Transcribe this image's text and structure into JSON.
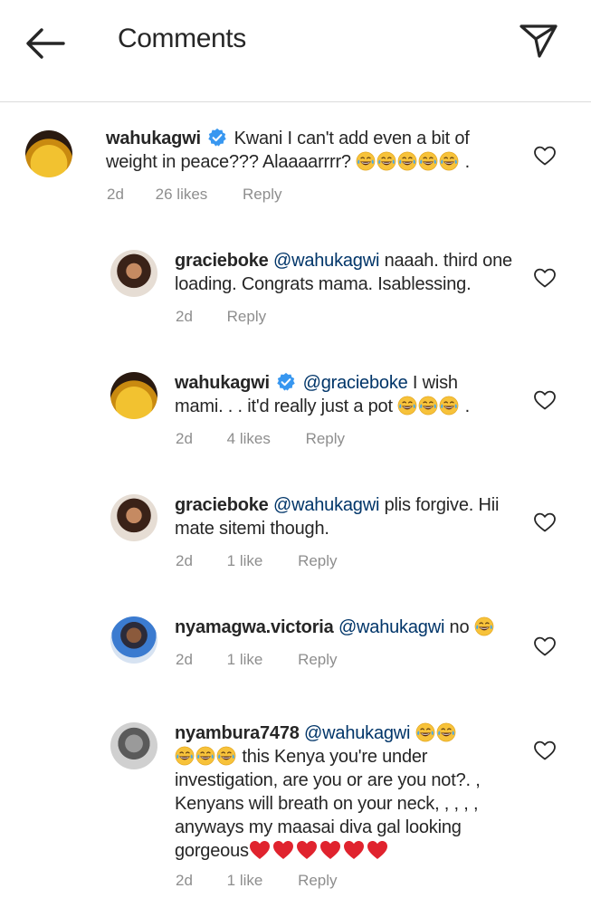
{
  "header": {
    "title": "Comments"
  },
  "comments": [
    {
      "username": "wahukagwi",
      "verified": true,
      "mention": "",
      "text_line1": "Kwani I can't add even a bit of",
      "text_line2": "weight in peace??? Alaaaarrrr?",
      "tail": ".",
      "emoji_count": 5,
      "time": "2d",
      "likes": "26 likes",
      "reply": "Reply"
    },
    {
      "username": "gracieboke",
      "mention": "@wahukagwi",
      "text_line1": "naaah. third one",
      "text_line2": "loading. Congrats mama. Isablessing.",
      "time": "2d",
      "reply": "Reply"
    },
    {
      "username": "wahukagwi",
      "verified": true,
      "mention": "@gracieboke",
      "text_line1": "I wish",
      "text_line2": "mami. . . it'd really just a pot",
      "tail": ".",
      "emoji_count": 3,
      "time": "2d",
      "likes": "4 likes",
      "reply": "Reply"
    },
    {
      "username": "gracieboke",
      "mention": "@wahukagwi",
      "text_line1": "plis forgive. Hii",
      "text_line2": "mate sitemi though.",
      "time": "2d",
      "likes": "1 like",
      "reply": "Reply"
    },
    {
      "username": "nyamagwa.victoria",
      "mention": "@wahukagwi",
      "text_line1": "no",
      "emoji_count": 1,
      "time": "2d",
      "likes": "1 like",
      "reply": "Reply"
    },
    {
      "username": "nyambura7478",
      "mention": "@wahukagwi",
      "text_line2": "this Kenya you're under",
      "text_line3": "investigation, are you or are you not?. ,",
      "text_line4": "Kenyans will breath on your neck, , , , ,",
      "text_line5": "anyways my maasai diva gal looking",
      "text_line6": "gorgeous",
      "heart_count": 6,
      "time": "2d",
      "likes": "1 like",
      "reply": "Reply"
    }
  ],
  "icons": {
    "back": "arrow-left-icon",
    "send": "paper-plane-icon",
    "like": "heart-outline-icon",
    "verified": "verified-badge-icon",
    "emoji": "tears-of-joy-emoji",
    "heart": "red-heart-emoji"
  },
  "colors": {
    "text": "#262626",
    "meta": "#8e8e8e",
    "mention": "#003569",
    "verified": "#3897f0",
    "heart": "#e0232e",
    "emoji": "#f7c23a"
  }
}
